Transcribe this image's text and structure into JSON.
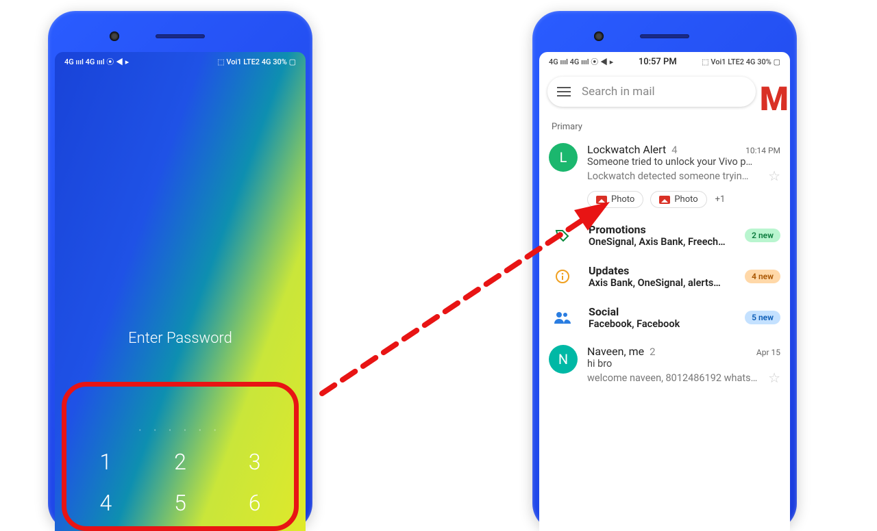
{
  "status_bar": {
    "left_text": "4G ıııl 4G ıııl ⦿ ◀ ▸",
    "right_text": "⬚ Voi1 LTE2 4G 30% ▢",
    "time": "10:57 PM"
  },
  "lockscreen": {
    "prompt": "Enter Password",
    "keys_row1": [
      "1",
      "2",
      "3"
    ],
    "keys_row2": [
      "4",
      "5",
      "6"
    ]
  },
  "gmail": {
    "search_placeholder": "Search in mail",
    "logo_letter": "M",
    "primary_label": "Primary",
    "email1": {
      "avatar_letter": "L",
      "sender": "Lockwatch Alert",
      "count": "4",
      "time": "10:14 PM",
      "subject": "Someone tried to unlock your Vivo p…",
      "snippet": "Lockwatch detected someone tryin…",
      "chip_label": "Photo",
      "chip_more": "+1"
    },
    "categories": [
      {
        "icon": "tag",
        "title": "Promotions",
        "desc": "OneSignal, Axis Bank, Freech…",
        "badge": "2 new",
        "badge_color": "green"
      },
      {
        "icon": "info",
        "title": "Updates",
        "desc": "Axis Bank, OneSignal, alerts…",
        "badge": "4 new",
        "badge_color": "orange"
      },
      {
        "icon": "social",
        "title": "Social",
        "desc": "Facebook, Facebook",
        "badge": "5 new",
        "badge_color": "blue"
      }
    ],
    "email2": {
      "avatar_letter": "N",
      "sender": "Naveen, me",
      "count": "2",
      "time": "Apr 15",
      "subject": "hi bro",
      "snippet": "welcome naveen, 8012486192 whats…"
    }
  }
}
